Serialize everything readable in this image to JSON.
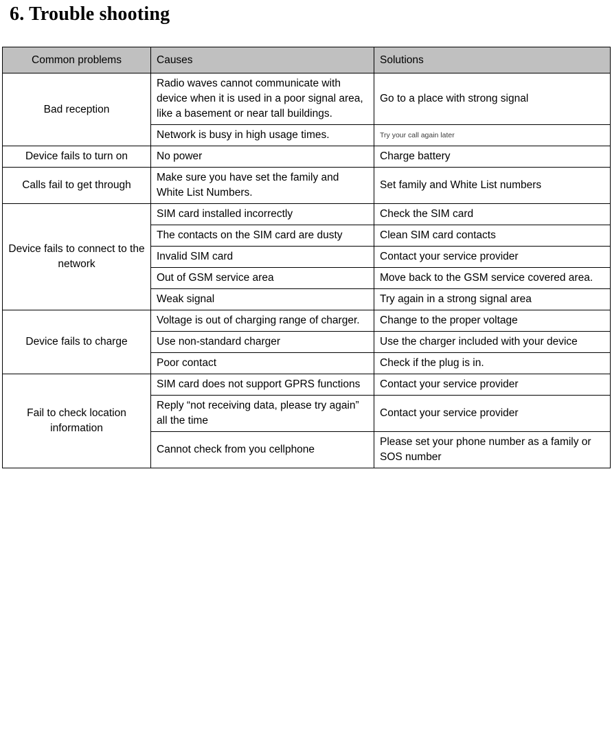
{
  "document": {
    "title": "6. Trouble shooting"
  },
  "table": {
    "headers": {
      "problems": "Common problems",
      "causes": "Causes",
      "solutions": "Solutions"
    },
    "rows": [
      {
        "problem": "Bad reception",
        "problem_rowspan": 2,
        "entries": [
          {
            "cause": "Radio waves cannot communicate with device when it is used in a poor signal area, like a basement or near tall buildings.",
            "solution": "Go to a place with strong signal",
            "solution_style": "normal"
          },
          {
            "cause": "Network is busy in high usage times.",
            "solution": "Try your call again later",
            "solution_style": "tiny"
          }
        ]
      },
      {
        "problem": "Device fails to turn on",
        "problem_rowspan": 1,
        "entries": [
          {
            "cause": "No power",
            "solution": "Charge battery",
            "solution_style": "normal"
          }
        ]
      },
      {
        "problem": "Calls fail to get through",
        "problem_rowspan": 1,
        "entries": [
          {
            "cause": "Make sure you have set the family and White List Numbers.",
            "solution": "Set family and White List numbers",
            "solution_style": "normal"
          }
        ]
      },
      {
        "problem": "Device fails to connect to the network",
        "problem_rowspan": 5,
        "entries": [
          {
            "cause": "SIM card installed incorrectly",
            "solution": "Check the SIM card",
            "solution_style": "normal"
          },
          {
            "cause": "The contacts on the SIM card are dusty",
            "solution": "Clean SIM card contacts",
            "solution_style": "normal"
          },
          {
            "cause": "Invalid SIM card",
            "solution": "Contact your service provider",
            "solution_style": "normal"
          },
          {
            "cause": "Out of GSM service area",
            "solution": "Move back to the GSM service covered area.",
            "solution_style": "normal"
          },
          {
            "cause": "Weak signal",
            "solution": "Try again in a strong signal area",
            "solution_style": "normal"
          }
        ]
      },
      {
        "problem": "Device fails to charge",
        "problem_rowspan": 3,
        "entries": [
          {
            "cause": "Voltage is out of charging range of charger.",
            "solution": "Change to the proper voltage",
            "solution_style": "normal"
          },
          {
            "cause": "Use non-standard charger",
            "solution": "Use the charger included with your device",
            "solution_style": "normal"
          },
          {
            "cause": "Poor contact",
            "solution": "Check if the plug is in.",
            "solution_style": "normal"
          }
        ]
      },
      {
        "problem": "Fail to check location information",
        "problem_rowspan": 3,
        "entries": [
          {
            "cause": "SIM card does not support GPRS functions",
            "solution": "Contact your service provider",
            "solution_style": "normal"
          },
          {
            "cause": "Reply “not receiving data, please try again” all the time",
            "solution": "Contact your service provider",
            "solution_style": "normal"
          },
          {
            "cause": "Cannot check from you cellphone",
            "solution": "Please set your phone number as a family or SOS number",
            "solution_style": "normal"
          }
        ]
      }
    ]
  },
  "style": {
    "header_background": "#c0c0c0",
    "border_color": "#000000",
    "text_color": "#000000",
    "tiny_note_color": "#3a3a3a"
  }
}
